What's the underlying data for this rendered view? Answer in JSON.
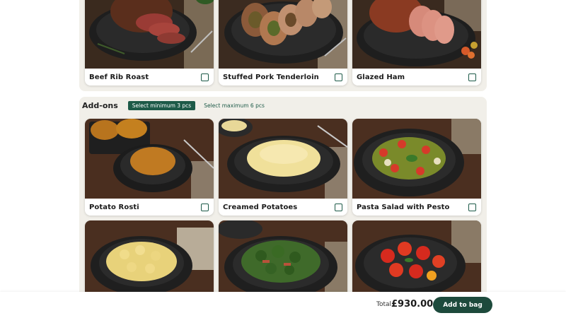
{
  "mains": {
    "items": [
      {
        "name": "Beef Rib Roast",
        "image": "beef-rib-roast-photo"
      },
      {
        "name": "Stuffed Pork Tenderloin",
        "image": "stuffed-pork-tenderloin-photo"
      },
      {
        "name": "Glazed Ham",
        "image": "glazed-ham-photo"
      }
    ]
  },
  "addons": {
    "title": "Add-ons",
    "min_badge": "Select minimum 3 pcs",
    "max_note": "Select maximum 6 pcs",
    "items": [
      {
        "name": "Potato Rosti",
        "image": "potato-rosti-photo"
      },
      {
        "name": "Creamed Potatoes",
        "image": "creamed-potatoes-photo"
      },
      {
        "name": "Pasta Salad with Pesto",
        "image": "pasta-salad-pesto-photo"
      },
      {
        "name": "",
        "image": "herb-potatoes-photo"
      },
      {
        "name": "",
        "image": "broccoli-bacon-salad-photo"
      },
      {
        "name": "",
        "image": "tomato-salad-photo"
      }
    ]
  },
  "footer": {
    "total_label": "Total",
    "total_value": "£930.00",
    "add_to_bag_label": "Add to bag"
  },
  "colors": {
    "accent": "#1d5a48",
    "button": "#1d4a3c",
    "section_bg": "#f1efe9"
  }
}
